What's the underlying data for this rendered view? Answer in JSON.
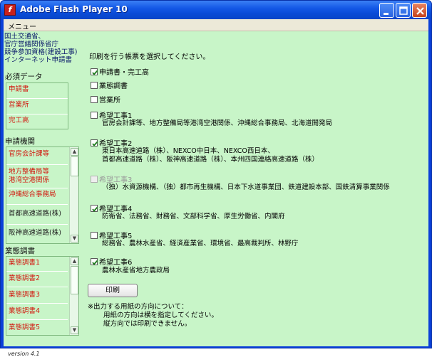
{
  "window": {
    "title": "Adobe Flash Player 10",
    "icon_name": "flash-player-icon"
  },
  "menubar": {
    "menu_label": "メニュー"
  },
  "sidebar": {
    "org_lines": [
      "国土交通省、",
      "官庁営繕関係省庁",
      "競争参加資格(建設工事)",
      "インターネット申請書"
    ],
    "required": {
      "heading": "必須データ",
      "items": [
        "申請書",
        "営業所",
        "完工高"
      ]
    },
    "applying_org": {
      "heading": "申請機関",
      "items": [
        {
          "label": "官房会計課等"
        },
        {
          "label": "地方整備局等",
          "label2": "港湾空港関係"
        },
        {
          "label": "沖縄総合事務局"
        },
        {
          "label": "首都高速道路(株)"
        },
        {
          "label": "阪神高速道路(株)"
        }
      ]
    },
    "business": {
      "heading": "業態調書",
      "items": [
        "業態調書1",
        "業態調書2",
        "業態調書3",
        "業態調書4",
        "業態調書5"
      ]
    },
    "version": "version 4.1"
  },
  "main": {
    "instruction": "印刷を行う帳票を選択してください。",
    "options": [
      {
        "label": "申請書・完工高",
        "checked": true,
        "disabled": false
      },
      {
        "label": "業態調書",
        "checked": false,
        "disabled": false
      },
      {
        "label": "営業所",
        "checked": false,
        "disabled": false
      },
      {
        "label": "希望工事1",
        "checked": false,
        "disabled": false,
        "desc": [
          "官房会計課等、地方整備局等港湾空港関係、沖縄総合事務局、北海道開発局"
        ]
      },
      {
        "label": "希望工事2",
        "checked": true,
        "disabled": false,
        "desc": [
          "東日本高速道路（株）、NEXCO中日本、NEXCO西日本、",
          "首都高速道路（株）、阪神高速道路（株）、本州四国連絡高速道路（株）"
        ]
      },
      {
        "label": "希望工事3",
        "checked": false,
        "disabled": true,
        "desc": [
          "（独）水資源機構、（独）都市再生機構、日本下水道事業団、鉄道建設本部、国鉄清算事業関係"
        ]
      },
      {
        "label": "希望工事4",
        "checked": true,
        "disabled": false,
        "desc": [
          "防衛省、法務省、財務省、文部科学省、厚生労働省、内閣府"
        ]
      },
      {
        "label": "希望工事5",
        "checked": false,
        "disabled": false,
        "desc": [
          "総務省、農林水産省、経済産業省、環境省、最高裁判所、林野庁"
        ]
      },
      {
        "label": "希望工事6",
        "checked": true,
        "disabled": false,
        "desc": [
          "農林水産省地方農政局"
        ]
      }
    ],
    "print_button": "印刷",
    "note_lines": [
      "※出力する用紙の方向について：",
      "用紙の方向は横を指定してください。",
      "縦方向では印刷できません。"
    ]
  },
  "colors": {
    "background": "#c8f5c8",
    "list_text": "#d2190f",
    "titlebar": "#0a4bd6"
  }
}
